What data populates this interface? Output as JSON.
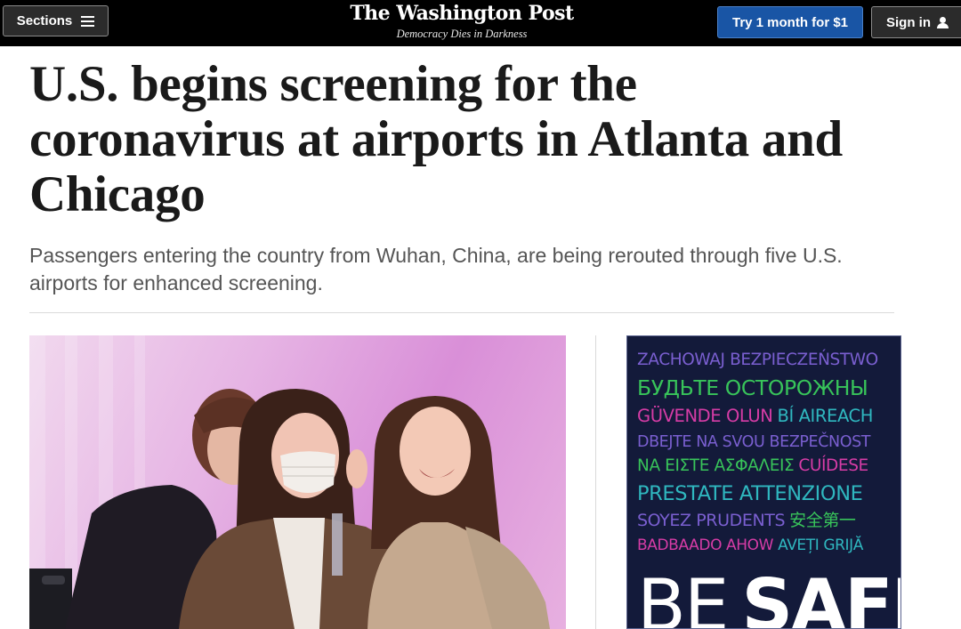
{
  "header": {
    "sections_label": "Sections",
    "sections_icon": "hamburger-icon",
    "logo": "The Washington Post",
    "tagline": "Democracy Dies in Darkness",
    "subscribe_label": "Try 1 month for $1",
    "signin_label": "Sign in",
    "signin_icon": "user-icon",
    "colors": {
      "bar": "#000000",
      "subscribe": "#1955a5"
    }
  },
  "article": {
    "headline": "U.S. begins screening for the coronavirus at airports in Atlanta and Chicago",
    "subheadline": "Passengers entering the country from Wuhan, China, are being rerouted through five U.S. airports for enhanced screening."
  },
  "ad": {
    "lines": [
      {
        "parts": [
          {
            "text": "ZACHOWAJ BEZPIECZEŃSTWO",
            "color": "#7a5fd0"
          }
        ]
      },
      {
        "parts": [
          {
            "text": "БУДЬТЕ ОСТОРОЖНЫ",
            "color": "#38c45a"
          }
        ]
      },
      {
        "parts": [
          {
            "text": "GÜVENDE OLUN",
            "color": "#d63ca6"
          },
          {
            "text": "BÍ AIREACH",
            "color": "#2fb7bf"
          }
        ]
      },
      {
        "parts": [
          {
            "text": "DBEJTE NA SVOU BEZPEČNOST",
            "color": "#7a5fd0"
          }
        ]
      },
      {
        "parts": [
          {
            "text": "ΝΑ ΕΙΣΤΕ ΑΣΦΑΛΕΙΣ",
            "color": "#38c45a"
          },
          {
            "text": "CUÍDESE",
            "color": "#d63ca6"
          }
        ]
      },
      {
        "parts": [
          {
            "text": "PRESTATE ATTENZIONE",
            "color": "#2fb7bf"
          }
        ]
      },
      {
        "parts": [
          {
            "text": "SOYEZ PRUDENTS",
            "color": "#7a5fd0"
          },
          {
            "text": "安全第一",
            "color": "#38c45a"
          }
        ]
      },
      {
        "parts": [
          {
            "text": "BADBAADO AHOW",
            "color": "#d63ca6"
          },
          {
            "text": "AVEȚI GRIJĂ",
            "color": "#2fb7bf"
          }
        ]
      }
    ],
    "be_label": "BE",
    "safe_label": "SAFE"
  }
}
